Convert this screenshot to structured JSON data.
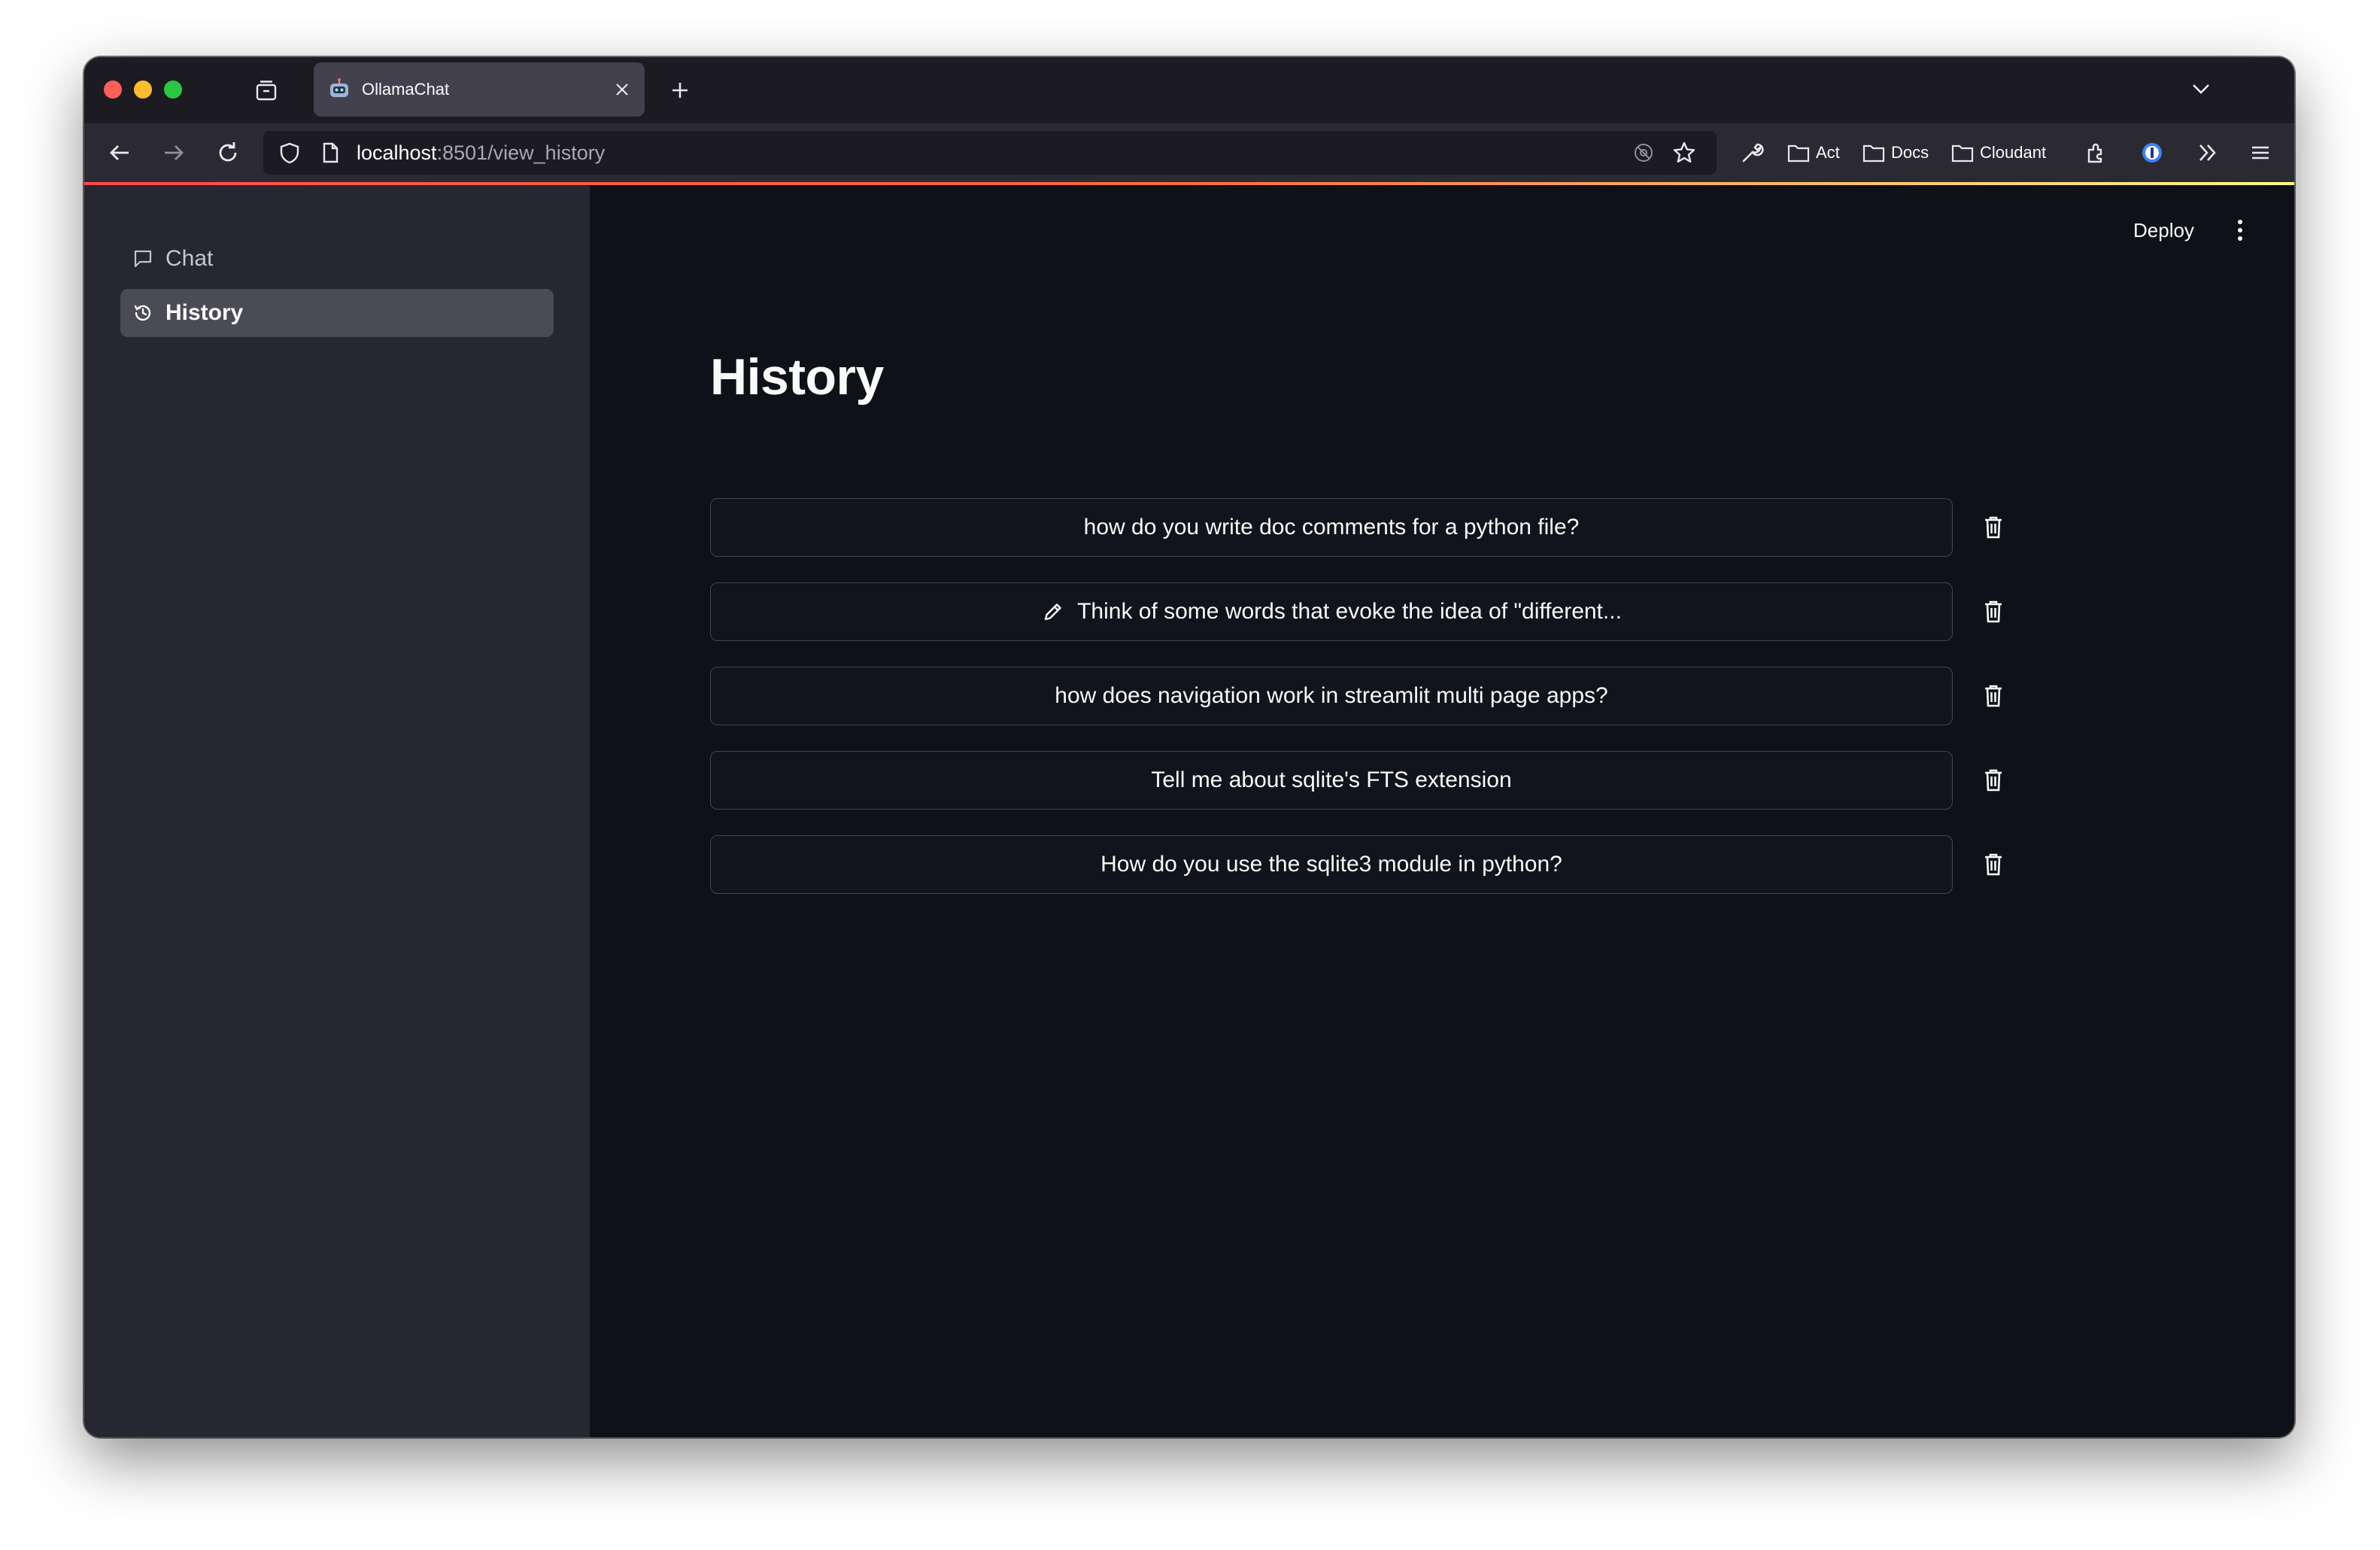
{
  "browser": {
    "tab_title": "OllamaChat",
    "url_host": "localhost",
    "url_path": ":8501/view_history",
    "bookmarks": [
      "Act",
      "Docs",
      "Cloudant"
    ]
  },
  "sidebar": {
    "items": [
      {
        "label": "Chat",
        "icon": "chat-bubble-icon",
        "active": false
      },
      {
        "label": "History",
        "icon": "history-icon",
        "active": true
      }
    ]
  },
  "header": {
    "deploy_label": "Deploy"
  },
  "main": {
    "title": "History",
    "history": [
      {
        "label": "how do you write doc comments for a python file?",
        "has_pencil": false
      },
      {
        "label": "Think of some words that evoke the idea of \"different...",
        "has_pencil": true
      },
      {
        "label": "how does navigation work in streamlit multi page apps?",
        "has_pencil": false
      },
      {
        "label": "Tell me about sqlite's FTS extension",
        "has_pencil": false
      },
      {
        "label": "How do you use the sqlite3 module in python?",
        "has_pencil": false
      }
    ]
  },
  "colors": {
    "sidebar_bg": "#262730",
    "main_bg": "#0e1117",
    "accent_red": "#ff4b4b",
    "accent_yellow": "#fffd80",
    "active_item_bg": "#4a4b55"
  }
}
